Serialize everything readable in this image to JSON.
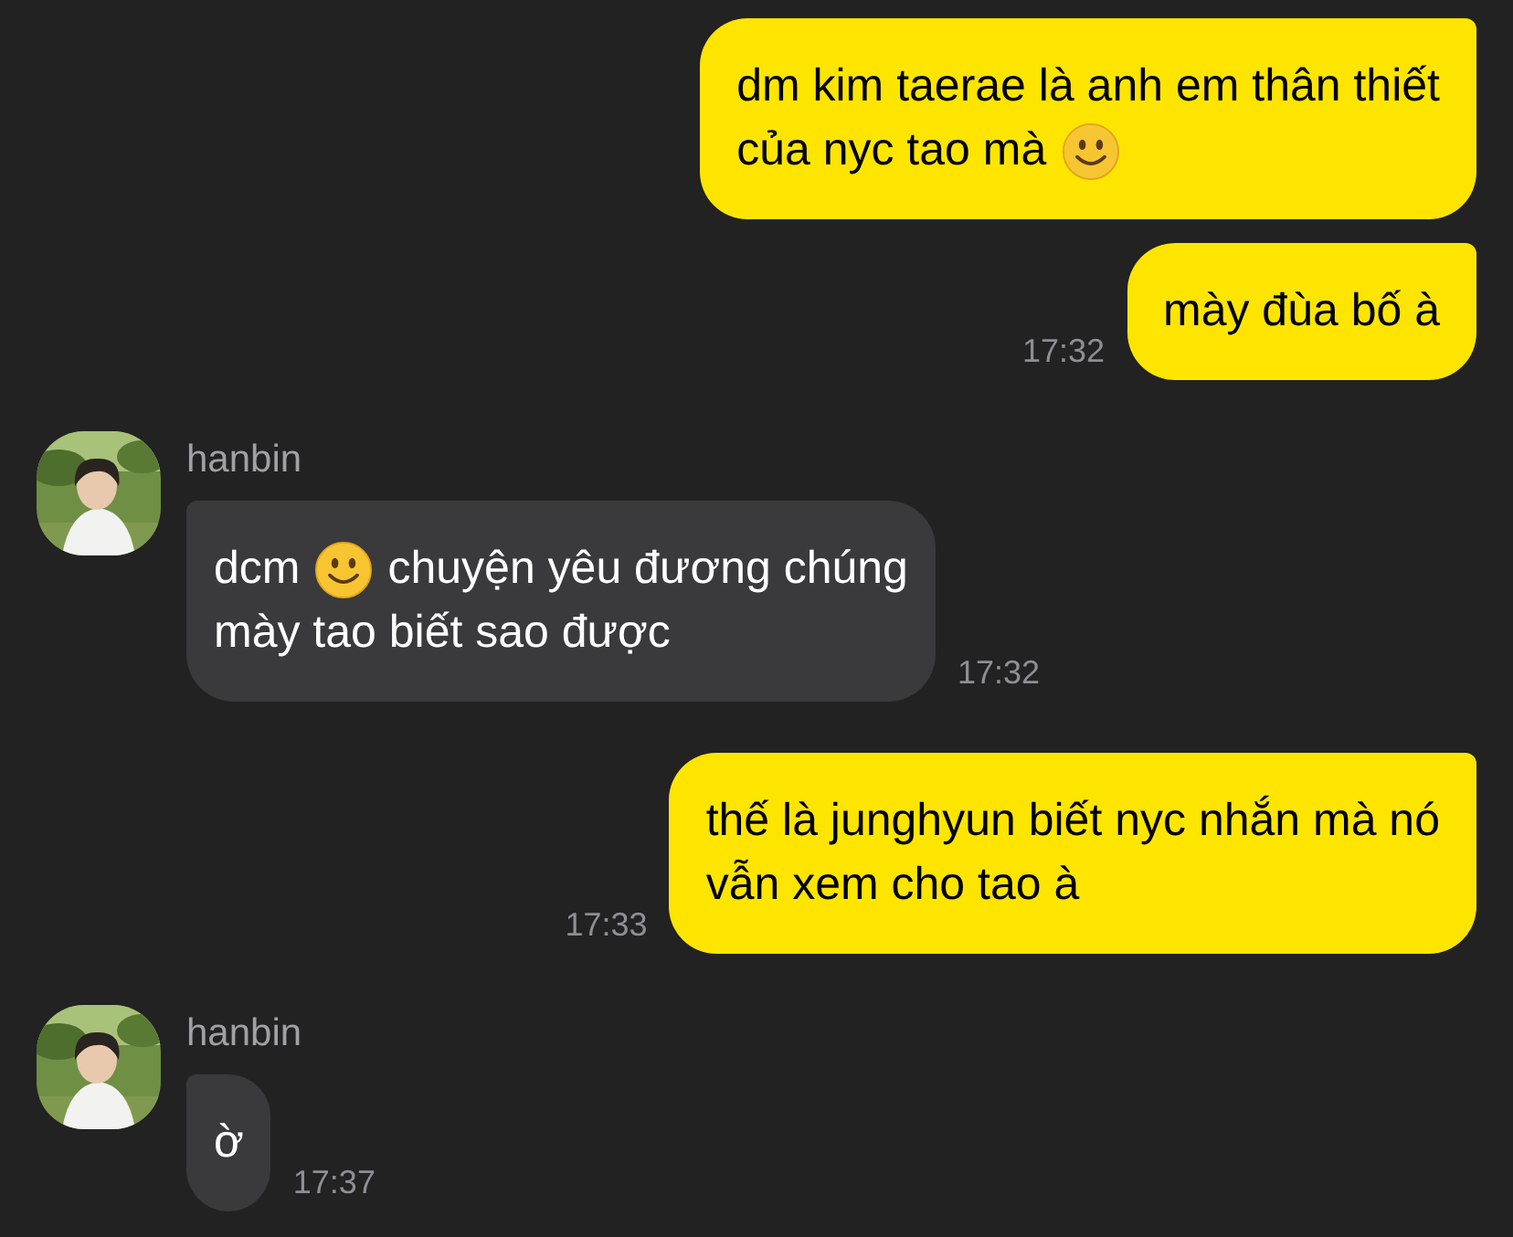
{
  "messages": [
    {
      "kind": "sent",
      "lines": [
        [
          {
            "kind": "text",
            "text": "dm kim taerae là anh em thân thiết"
          }
        ],
        [
          {
            "kind": "text",
            "text": "của nyc tao mà"
          },
          {
            "kind": "emoji"
          }
        ]
      ]
    },
    {
      "kind": "sent",
      "lines": [
        [
          {
            "kind": "text",
            "text": "mày đùa bố à"
          }
        ]
      ],
      "time": "17:32"
    },
    {
      "kind": "received",
      "sender": "hanbin",
      "lines": [
        [
          {
            "kind": "text",
            "text": "dcm"
          },
          {
            "kind": "emoji"
          },
          {
            "kind": "text",
            "text": "chuyện yêu đương chúng"
          }
        ],
        [
          {
            "kind": "text",
            "text": "mày tao biết sao được"
          }
        ]
      ],
      "time": "17:32"
    },
    {
      "kind": "sent",
      "lines": [
        [
          {
            "kind": "text",
            "text": "thế là junghyun biết nyc nhắn mà nó"
          }
        ],
        [
          {
            "kind": "text",
            "text": "vẫn xem cho tao à"
          }
        ]
      ],
      "time": "17:33"
    },
    {
      "kind": "received",
      "sender": "hanbin",
      "lines": [
        [
          {
            "kind": "text",
            "text": "ờ"
          }
        ]
      ],
      "time": "17:37"
    }
  ]
}
